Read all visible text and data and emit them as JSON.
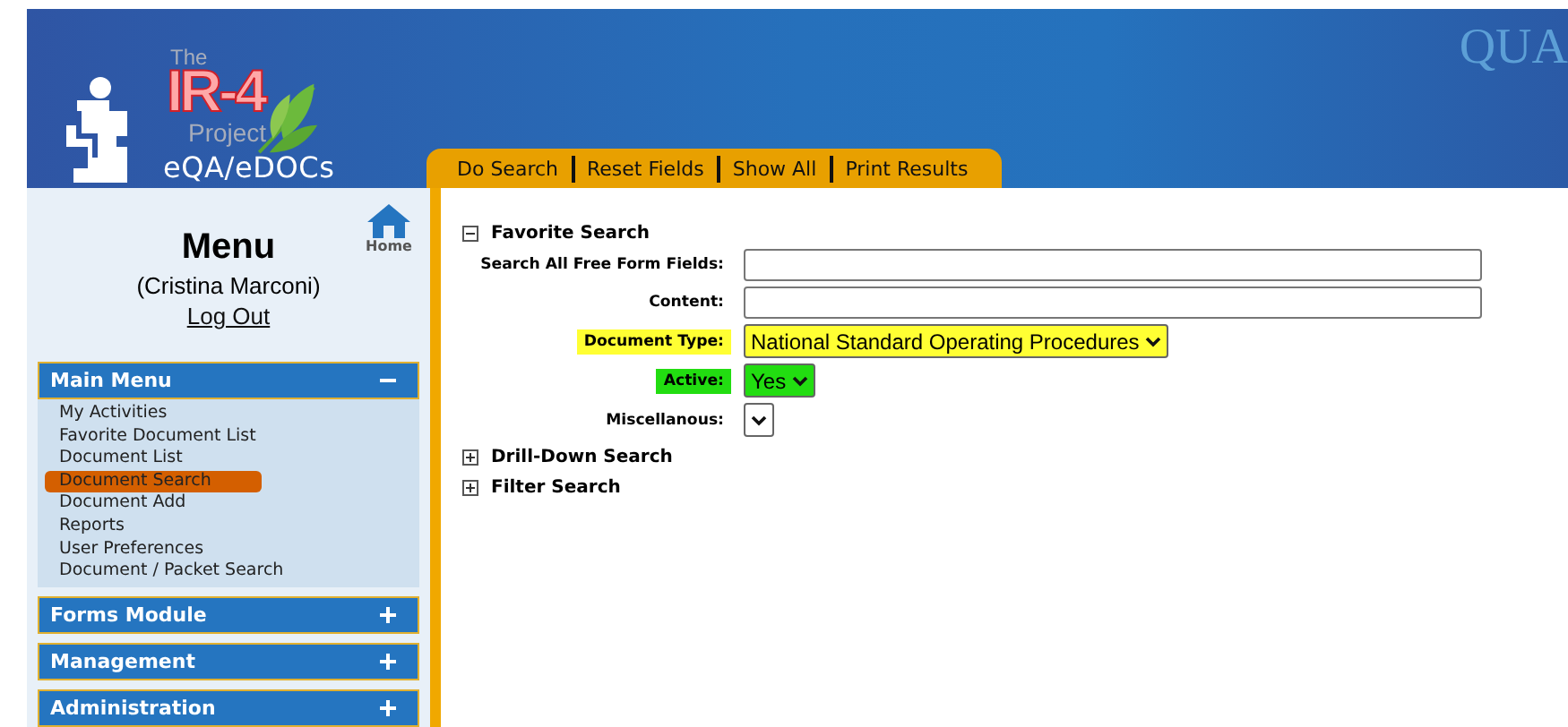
{
  "header": {
    "logo": {
      "the": "The",
      "name": "IR-4",
      "project": "Project",
      "product": "eQA/eDOCs"
    },
    "banner_text": "QUA",
    "toolbar": [
      "Do Search",
      "Reset Fields",
      "Show All",
      "Print Results"
    ]
  },
  "sidebar": {
    "title": "Menu",
    "home": "Home",
    "user": "(Cristina Marconi)",
    "logout": "Log Out",
    "sections": [
      {
        "title": "Main Menu",
        "expanded": true,
        "items": [
          {
            "label": "My Activities"
          },
          {
            "label": "Favorite Document List"
          },
          {
            "label": "Document List"
          },
          {
            "label": "Document Search",
            "color": "#d45f00"
          },
          {
            "label": "Document Add"
          },
          {
            "label": "Reports"
          },
          {
            "label": "User Preferences"
          },
          {
            "label": "Document / Packet Search"
          }
        ]
      },
      {
        "title": "Forms Module",
        "expanded": false
      },
      {
        "title": "Management",
        "expanded": false
      },
      {
        "title": "Administration",
        "expanded": false
      }
    ]
  },
  "search_groups": [
    {
      "title": "Favorite Search",
      "expanded": true,
      "fields": [
        {
          "label": "Search All Free Form Fields:",
          "kind": "text"
        },
        {
          "label": "Content:",
          "kind": "text"
        },
        {
          "label": "Document Type:",
          "kind": "select",
          "value": "National Standard Operating Procedures",
          "color": "#ffff33"
        },
        {
          "label": "Active:",
          "kind": "select",
          "value": "Yes",
          "color": "#22dd11"
        },
        {
          "label": "Miscellanous:",
          "kind": "select"
        }
      ]
    },
    {
      "title": "Drill-Down Search",
      "expanded": false
    },
    {
      "title": "Filter Search",
      "expanded": false
    }
  ]
}
